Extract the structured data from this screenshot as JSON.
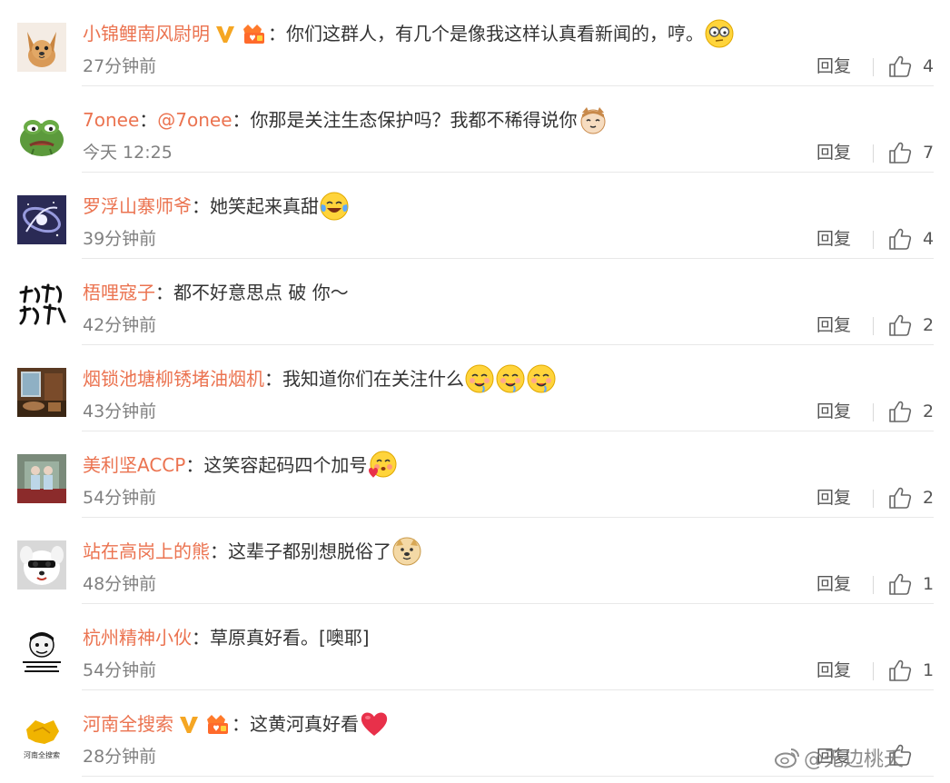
{
  "comments": [
    {
      "user": "小锦鲤南风尉明",
      "verified": true,
      "fan_badge": true,
      "mention": "",
      "text": "你们这群人，有几个是像我这样认真看新闻的，哼。",
      "emojis": [
        "skeptical-glasses-emoji"
      ],
      "time": "27分钟前",
      "reply_label": "回复",
      "likes": "4",
      "avatar": "puppy-avatar"
    },
    {
      "user": "7onee",
      "verified": false,
      "fan_badge": false,
      "mention": "@7onee",
      "text": "你那是关注生态保护吗？我都不稀得说你",
      "emojis": [
        "cat-emoji"
      ],
      "time": "今天 12:25",
      "reply_label": "回复",
      "likes": "7",
      "avatar": "pepe-frog-avatar"
    },
    {
      "user": "罗浮山寨师爷",
      "verified": false,
      "fan_badge": false,
      "mention": "",
      "text": "她笑起来真甜",
      "emojis": [
        "laugh-cry-emoji"
      ],
      "time": "39分钟前",
      "reply_label": "回复",
      "likes": "4",
      "avatar": "galaxy-avatar"
    },
    {
      "user": "梧哩寇子",
      "verified": false,
      "fan_badge": false,
      "mention": "",
      "text": "都不好意思点 破 你～",
      "emojis": [],
      "time": "42分钟前",
      "reply_label": "回复",
      "likes": "2",
      "avatar": "calligraphy-avatar"
    },
    {
      "user": "烟锁池塘柳锈堵油烟机",
      "verified": false,
      "fan_badge": false,
      "mention": "",
      "text": "我知道你们在关注什么",
      "emojis": [
        "drooling-emoji",
        "drooling-emoji",
        "drooling-emoji"
      ],
      "time": "43分钟前",
      "reply_label": "回复",
      "likes": "2",
      "avatar": "room-photo-avatar"
    },
    {
      "user": "美利坚ACCP",
      "verified": false,
      "fan_badge": false,
      "mention": "",
      "text": "这笑容起码四个加号",
      "emojis": [
        "blush-heart-emoji"
      ],
      "time": "54分钟前",
      "reply_label": "回复",
      "likes": "2",
      "avatar": "twins-avatar"
    },
    {
      "user": "站在高岗上的熊",
      "verified": false,
      "fan_badge": false,
      "mention": "",
      "text": "这辈子都别想脱俗了",
      "emojis": [
        "doge-emoji"
      ],
      "time": "48分钟前",
      "reply_label": "回复",
      "likes": "1",
      "avatar": "white-dog-avatar"
    },
    {
      "user": "杭州精神小伙",
      "verified": false,
      "fan_badge": false,
      "mention": "",
      "text": "草原真好看。[噢耶]",
      "emojis": [],
      "time": "54分钟前",
      "reply_label": "回复",
      "likes": "1",
      "avatar": "meme-sketch-avatar"
    },
    {
      "user": "河南全搜索",
      "verified": true,
      "fan_badge": true,
      "mention": "",
      "text": "这黄河真好看",
      "emojis": [
        "heart-emoji"
      ],
      "time": "28分钟前",
      "reply_label": "回复",
      "likes": "",
      "avatar": "henan-map-avatar",
      "avatar_caption": "河南全搜索"
    }
  ],
  "watermark": "@无边桃夭",
  "colors": {
    "name": "#eb7350",
    "text": "#333333",
    "meta": "#808080",
    "divider": "#e8e8e8",
    "verified": "#f5a623"
  }
}
